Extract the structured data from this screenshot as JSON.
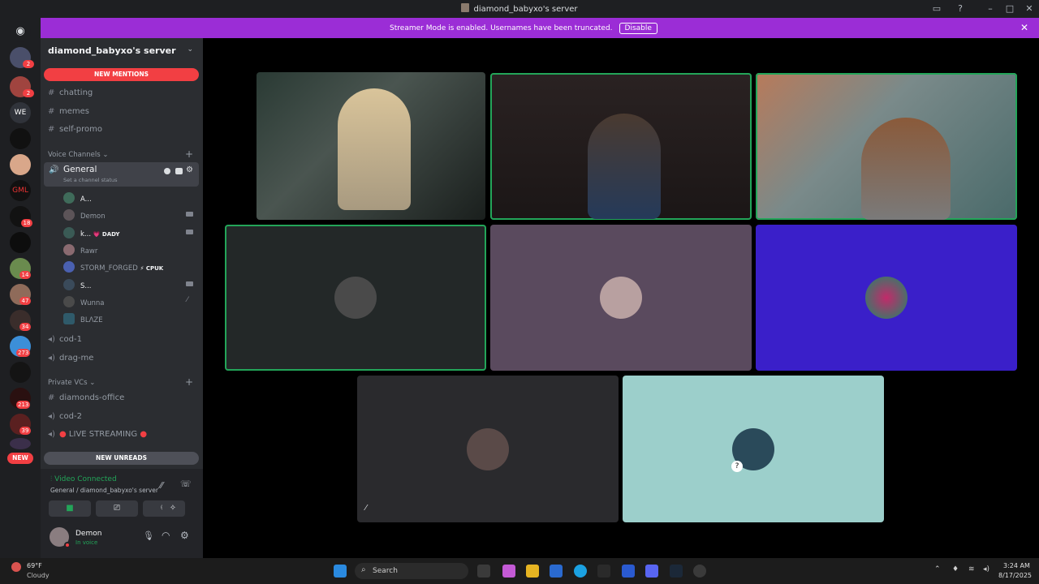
{
  "window": {
    "title": "diamond_babyxo's server"
  },
  "banner": {
    "message": "Streamer Mode is enabled. Usernames have been truncated.",
    "disable_label": "Disable"
  },
  "rail": {
    "badges": [
      "2",
      "2",
      "18",
      "14",
      "47",
      "34",
      "273",
      "213",
      "39"
    ],
    "new_label": "NEW"
  },
  "sidebar": {
    "server_name": "diamond_babyxo's server",
    "new_mentions": "NEW MENTIONS",
    "text_channels": [
      "chatting",
      "memes",
      "self-promo"
    ],
    "voice_category": "Voice Channels",
    "active_voice": {
      "name": "General",
      "status_placeholder": "Set a channel status"
    },
    "voice_users": [
      {
        "name": "A...",
        "tag": ""
      },
      {
        "name": "Demon",
        "tag": ""
      },
      {
        "name": "k...",
        "tag": "💗 DADY"
      },
      {
        "name": "Rawr",
        "tag": ""
      },
      {
        "name": "STORM_FORGED",
        "tag": "⚡ CPUK"
      },
      {
        "name": "S...",
        "tag": ""
      },
      {
        "name": "Wunna",
        "tag": ""
      },
      {
        "name": "BLΛZE",
        "tag": ""
      }
    ],
    "other_voice": [
      "cod-1",
      "drag-me"
    ],
    "private_category": "Private VCs",
    "private_channels": [
      "diamonds-office",
      "cod-2",
      "LIVE STREAMING"
    ],
    "new_unreads": "NEW UNREADS"
  },
  "voice_panel": {
    "status": "Video Connected",
    "location": "General / diamond_babyxo's server"
  },
  "user": {
    "name": "Demon",
    "status": "In voice"
  },
  "taskbar": {
    "weather_temp": "69°F",
    "weather_desc": "Cloudy",
    "search_placeholder": "Search",
    "time": "3:24 AM",
    "date": "8/17/2025"
  },
  "colors": {
    "banner": "#9b2dd6",
    "speaking": "#23a559",
    "mention": "#f23f43",
    "tile_blue": "#3a1fc9",
    "tile_mauve": "#5a4a5e",
    "tile_teal": "#9ccfcb"
  }
}
